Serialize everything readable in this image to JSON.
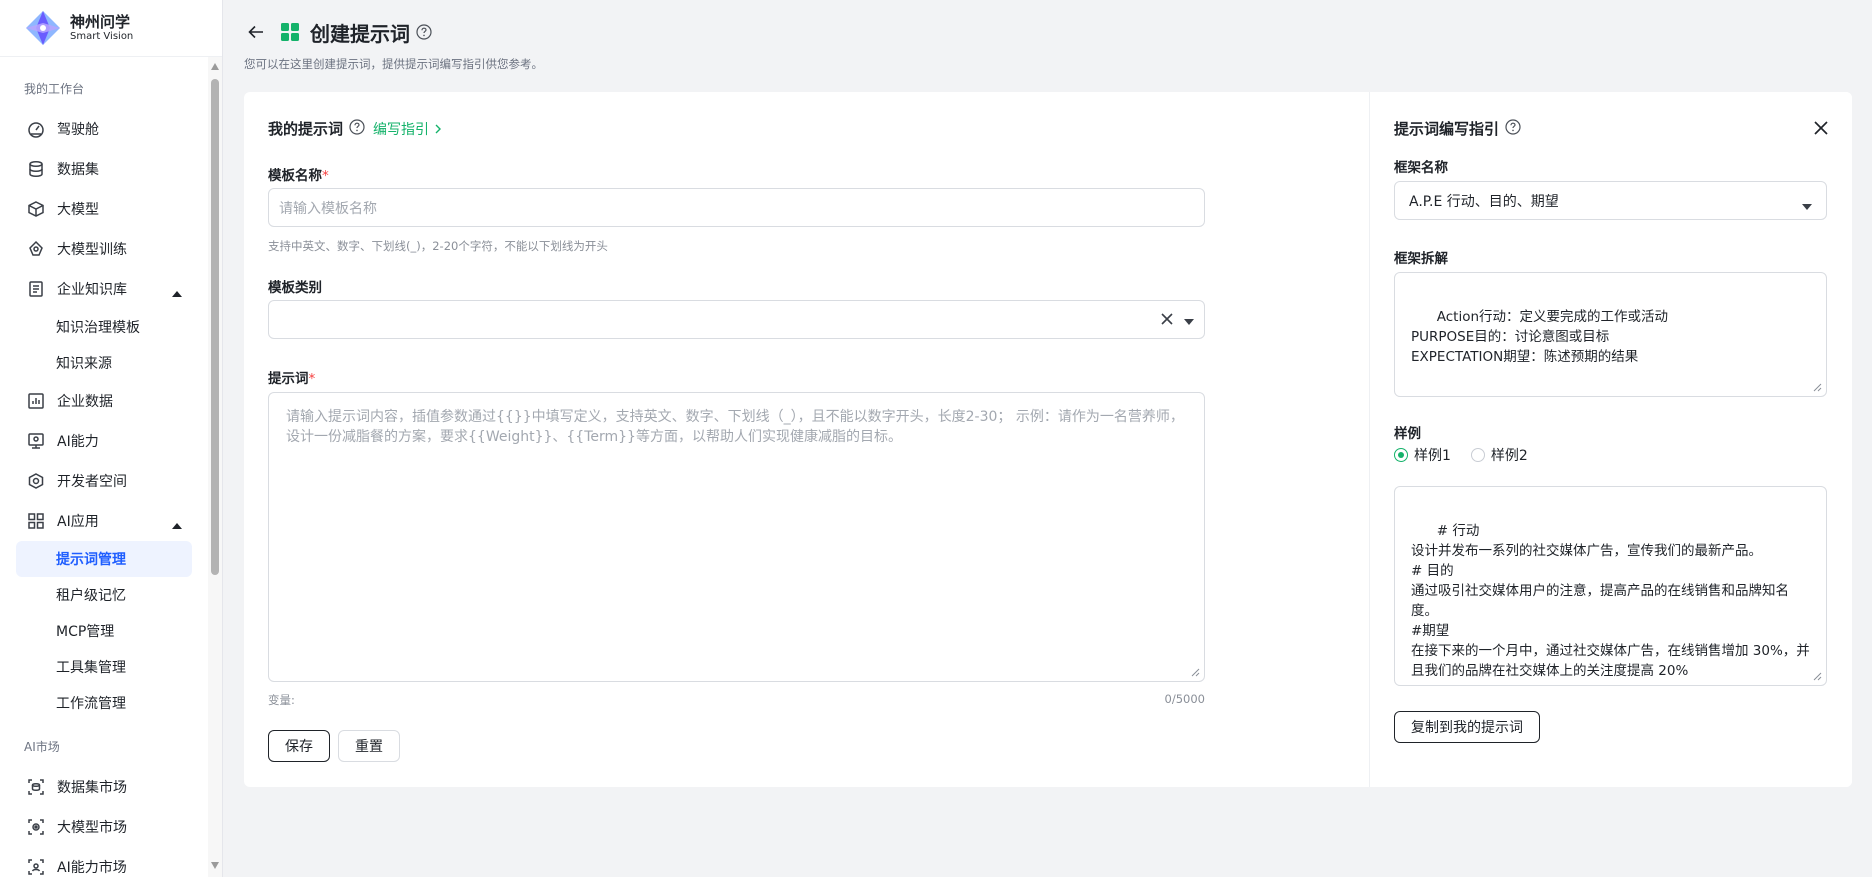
{
  "app": {
    "name_cn": "神州问学",
    "name_en": "Smart Vision"
  },
  "sidebar": {
    "section_workspace": "我的工作台",
    "items": [
      {
        "label": "驾驶舱",
        "icon": "cockpit-icon"
      },
      {
        "label": "数据集",
        "icon": "database-icon"
      },
      {
        "label": "大模型",
        "icon": "cube-icon"
      },
      {
        "label": "大模型训练",
        "icon": "training-icon"
      },
      {
        "label": "企业知识库",
        "icon": "knowledge-icon"
      },
      {
        "label": "企业数据",
        "icon": "chart-icon"
      },
      {
        "label": "AI能力",
        "icon": "ai-ability-icon"
      },
      {
        "label": "开发者空间",
        "icon": "developer-icon"
      },
      {
        "label": "AI应用",
        "icon": "grid-icon"
      }
    ],
    "knowledge_sub": [
      "知识治理模板",
      "知识来源"
    ],
    "ai_app_sub": [
      "提示词管理",
      "租户级记忆",
      "MCP管理",
      "工具集管理",
      "工作流管理"
    ],
    "section_market": "AI市场",
    "market_items": [
      "数据集市场",
      "大模型市场",
      "AI能力市场"
    ]
  },
  "header": {
    "title": "创建提示词",
    "description": "您可以在这里创建提示词，提供提示词编写指引供您参考。"
  },
  "form": {
    "section_title": "我的提示词",
    "guide_link": "编写指引",
    "name_label": "模板名称",
    "required_mark": "*",
    "name_placeholder": "请输入模板名称",
    "name_hint": "支持中英文、数字、下划线(_)，2-20个字符，不能以下划线为开头",
    "category_label": "模板类别",
    "prompt_label": "提示词",
    "prompt_placeholder": "请输入提示词内容，插值参数通过{{}}中填写定义，支持英文、数字、下划线（_），且不能以数字开头，长度2-30； 示例：请作为一名营养师，设计一份减脂餐的方案，要求{{Weight}}、{{Term}}等方面，以帮助人们实现健康减脂的目标。",
    "variables_label": "变量:",
    "char_count": "0/5000",
    "save_button": "保存",
    "reset_button": "重置"
  },
  "guide": {
    "title": "提示词编写指引",
    "framework_label": "框架名称",
    "framework_value": "A.P.E 行动、目的、期望",
    "breakdown_label": "框架拆解",
    "breakdown_text": "Action行动：定义要完成的工作或活动\nPURPOSE目的：讨论意图或目标\nEXPECTATION期望：陈述预期的结果",
    "example_label": "样例",
    "example_options": [
      "样例1",
      "样例2"
    ],
    "example_selected": "样例1",
    "example_text": "# 行动\n设计并发布一系列的社交媒体广告，宣传我们的最新产品。\n# 目的\n通过吸引社交媒体用户的注意，提高产品的在线销售和品牌知名度。\n#期望\n在接下来的一个月中，通过社交媒体广告，在线销售增加 30%，并且我们的品牌在社交媒体上的关注度提高 20%",
    "copy_button": "复制到我的提示词"
  },
  "colors": {
    "accent_green": "#14b26a",
    "active_blue": "#1f5eff",
    "required_red": "#f53f3f"
  }
}
